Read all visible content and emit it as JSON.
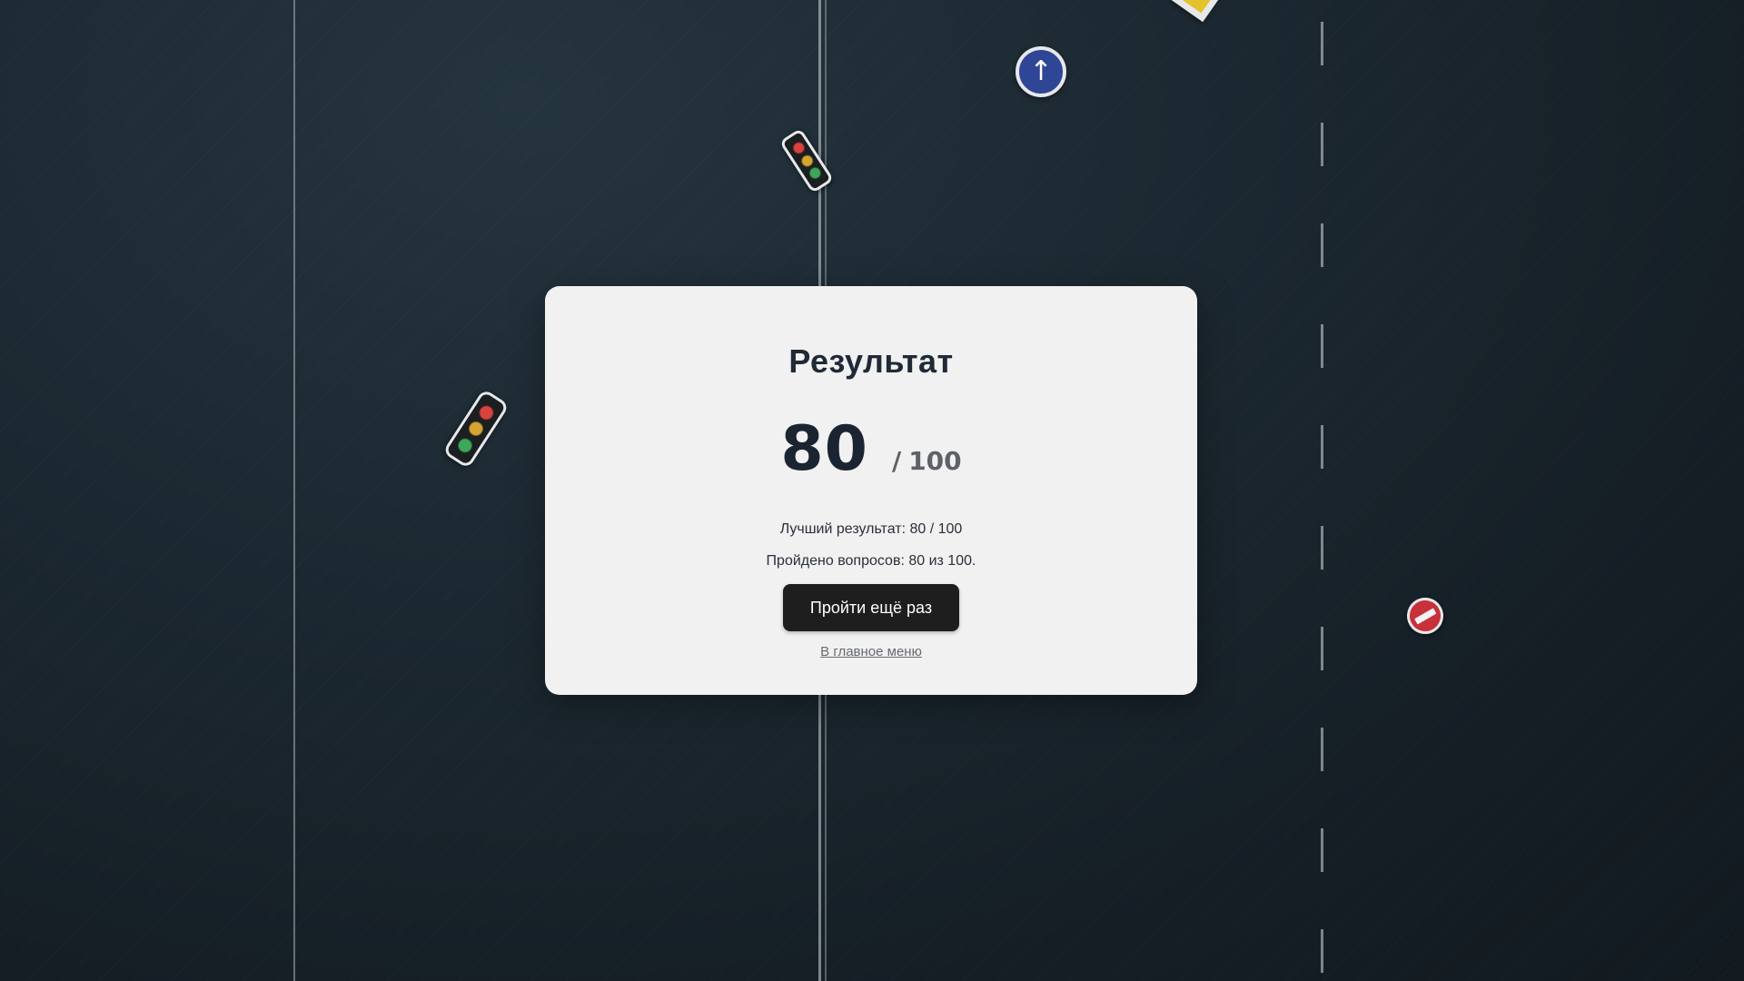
{
  "result_card": {
    "title": "Результат",
    "score": "80",
    "score_separator": "/",
    "score_max": "100",
    "best_result": "Лучший результат: 80 / 100",
    "questions_passed": "Пройдено вопросов: 80 из 100.",
    "retry_button_label": "Пройти ещё раз",
    "main_menu_link": "В главное меню"
  },
  "background": {
    "signs": [
      {
        "name": "traffic-light-icon"
      },
      {
        "name": "traffic-light-icon"
      },
      {
        "name": "ahead-only-sign-icon",
        "glyph": "↑",
        "color": "#2f4596"
      },
      {
        "name": "no-entry-sign-icon",
        "color": "#c8303a"
      },
      {
        "name": "priority-road-sign-icon",
        "color": "#e3c22e"
      }
    ]
  },
  "colors": {
    "background": "#1d2a33",
    "card": "#f1f1f2",
    "button": "#1e1e1f",
    "title_text": "#1f2a36"
  }
}
